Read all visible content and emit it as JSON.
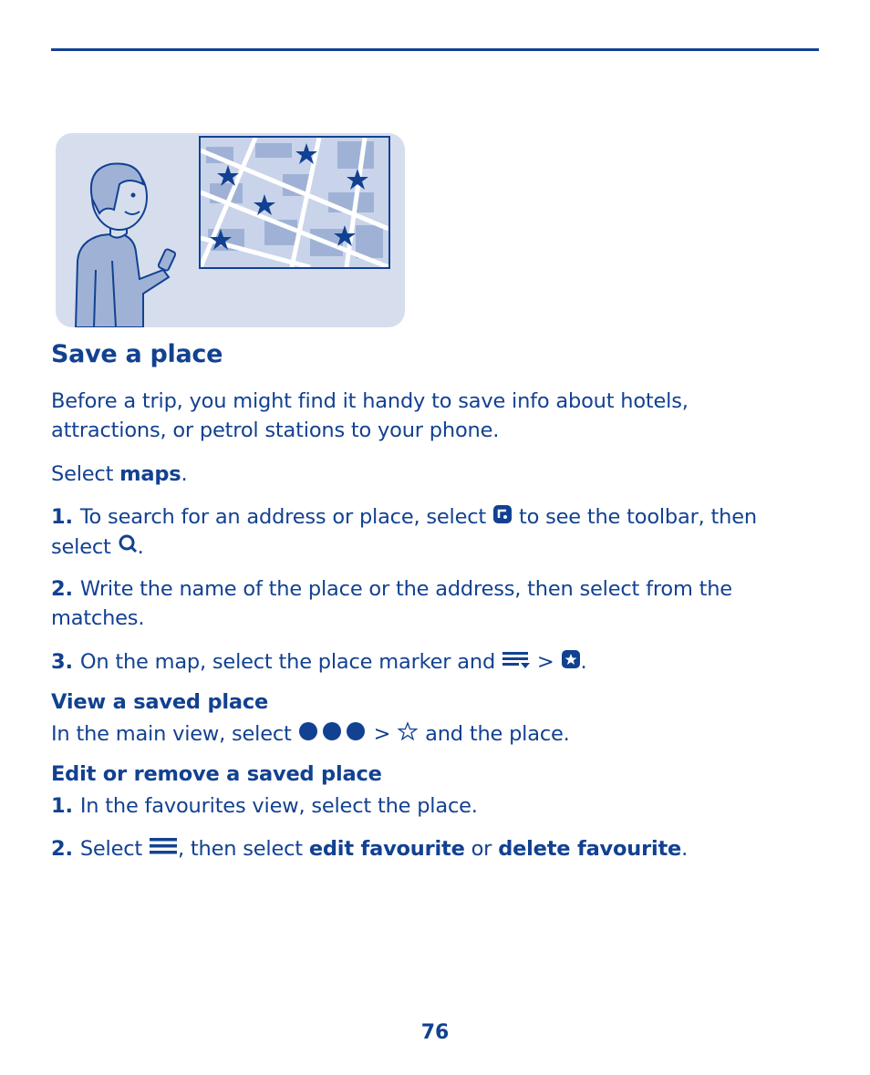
{
  "header": {
    "rule_color": "#124191"
  },
  "illustration": {
    "description": "man-holding-phone-looking-at-map-with-star-markers",
    "star_count": 6
  },
  "section": {
    "title": "Save a place",
    "intro_line1": "Before a trip, you might find it handy to save info about hotels,",
    "intro_line2": "attractions, or petrol stations to your phone.",
    "select_prefix": "Select ",
    "select_app": "maps",
    "select_suffix": "."
  },
  "steps": [
    {
      "num": "1.",
      "text_a": "To search for an address or place, select ",
      "icon1": "toolbar-toggle-icon",
      "text_b": " to see the toolbar, then",
      "text_c": "select ",
      "icon2": "search-icon",
      "text_d": "."
    },
    {
      "num": "2.",
      "text_a": "Write the name of the place or the address, then select from the",
      "text_b": "matches."
    },
    {
      "num": "3.",
      "text_a": "On the map, select the place marker and ",
      "icon1": "options-menu-icon",
      "sep": " > ",
      "icon2": "favourite-star-button-icon",
      "text_b": "."
    }
  ],
  "view_saved": {
    "title": "View a saved place",
    "text_a": "In the main view, select ",
    "icon1": "more-dots-icon",
    "sep": " > ",
    "icon2": "star-outline-icon",
    "text_b": " and the place."
  },
  "edit_saved": {
    "title": "Edit or remove a saved place",
    "steps": [
      {
        "num": "1.",
        "text": "In the favourites view, select the place."
      },
      {
        "num": "2.",
        "text_a": "Select ",
        "icon": "menu-icon",
        "text_b": ", then select ",
        "bold1": "edit favourite",
        "text_c": " or ",
        "bold2": "delete favourite",
        "text_d": "."
      }
    ]
  },
  "footer": {
    "page_number": "76"
  },
  "colors": {
    "text": "#124191",
    "illustration_bg": "#d6deee",
    "map_block": "#9fb2d6"
  }
}
